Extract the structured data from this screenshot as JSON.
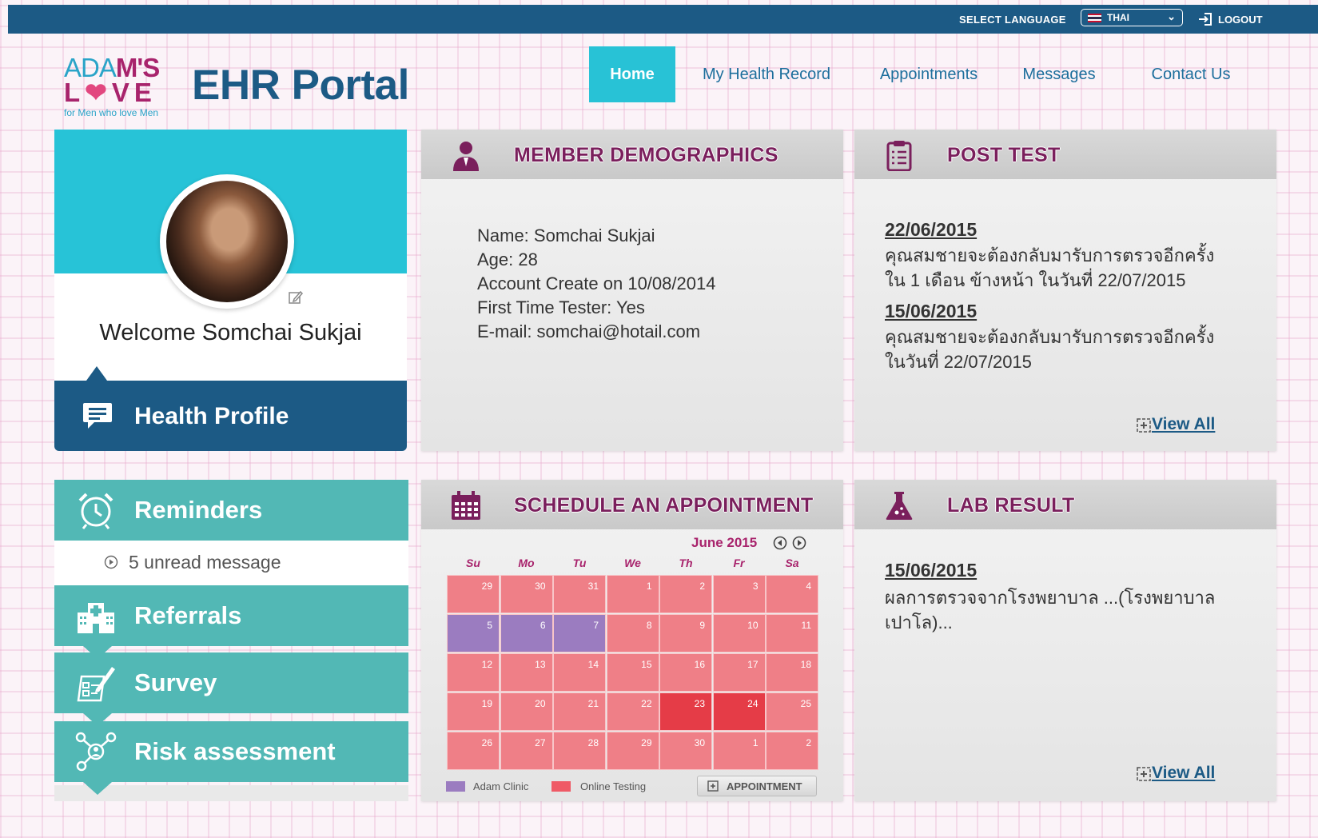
{
  "header": {
    "select_language_label": "SELECT LANGUAGE",
    "language": "THAI",
    "logout_label": "LOGOUT"
  },
  "logo": {
    "line1_a": "ADA",
    "line1_b": "M'S",
    "line2_a": "L",
    "line2_b": "VE",
    "tagline": "for Men who love Men",
    "portal_title": "EHR Portal"
  },
  "nav": {
    "items": [
      {
        "label": "Home",
        "active": true
      },
      {
        "label": "My Health Record"
      },
      {
        "label": "Appointments"
      },
      {
        "label": "Messages"
      },
      {
        "label": "Contact Us"
      }
    ]
  },
  "profile": {
    "welcome": "Welcome Somchai Sukjai",
    "health_profile_label": "Health Profile"
  },
  "sidebar": {
    "reminders_label": "Reminders",
    "unread_text": "5 unread message",
    "referrals_label": "Referrals",
    "survey_label": "Survey",
    "risk_label": "Risk assessment"
  },
  "demographics": {
    "title": "MEMBER DEMOGRAPHICS",
    "lines": [
      "Name: Somchai Sukjai",
      "Age: 28",
      "Account Create on 10/08/2014",
      "First Time Tester: Yes",
      "E-mail: somchai@hotail.com"
    ]
  },
  "post_test": {
    "title": "POST TEST",
    "entries": [
      {
        "date": "22/06/2015",
        "line1": "คุณสมชายจะต้องกลับมารับการตรวจอีกครั้ง",
        "line2": "ใน 1 เดือน ข้างหน้า ในวันที่ 22/07/2015"
      },
      {
        "date": "15/06/2015",
        "line1": "คุณสมชายจะต้องกลับมารับการตรวจอีกครั้ง",
        "line2": "ในวันที่ 22/07/2015"
      }
    ],
    "view_all": "View All"
  },
  "schedule": {
    "title": "SCHEDULE AN APPOINTMENT",
    "month": "June 2015",
    "days_of_week": [
      "Su",
      "Mo",
      "Tu",
      "We",
      "Th",
      "Fr",
      "Sa"
    ],
    "weeks": [
      [
        "29",
        "30",
        "31",
        "1",
        "2",
        "3",
        "4"
      ],
      [
        "5",
        "6",
        "7",
        "8",
        "9",
        "10",
        "11"
      ],
      [
        "12",
        "13",
        "14",
        "15",
        "16",
        "17",
        "18"
      ],
      [
        "19",
        "20",
        "21",
        "22",
        "23",
        "24",
        "25"
      ],
      [
        "26",
        "27",
        "28",
        "29",
        "30",
        "1",
        "2"
      ]
    ],
    "adam_clinic_days": [
      "5",
      "6",
      "7"
    ],
    "highlighted_days": [
      "23",
      "24"
    ],
    "legend": {
      "adam_clinic": "Adam Clinic",
      "online_testing": "Online Testing"
    },
    "appointment_button": "APPOINTMENT",
    "colors": {
      "adam_clinic": "#9b7cc0",
      "online_testing": "#ef7f87",
      "highlight": "#e53c47"
    }
  },
  "lab_result": {
    "title": "LAB RESULT",
    "date": "15/06/2015",
    "line1": "ผลการตรวจจากโรงพยาบาล   ...(โรงพยาบาล",
    "line2": "เปาโล)...",
    "view_all": "View All"
  }
}
